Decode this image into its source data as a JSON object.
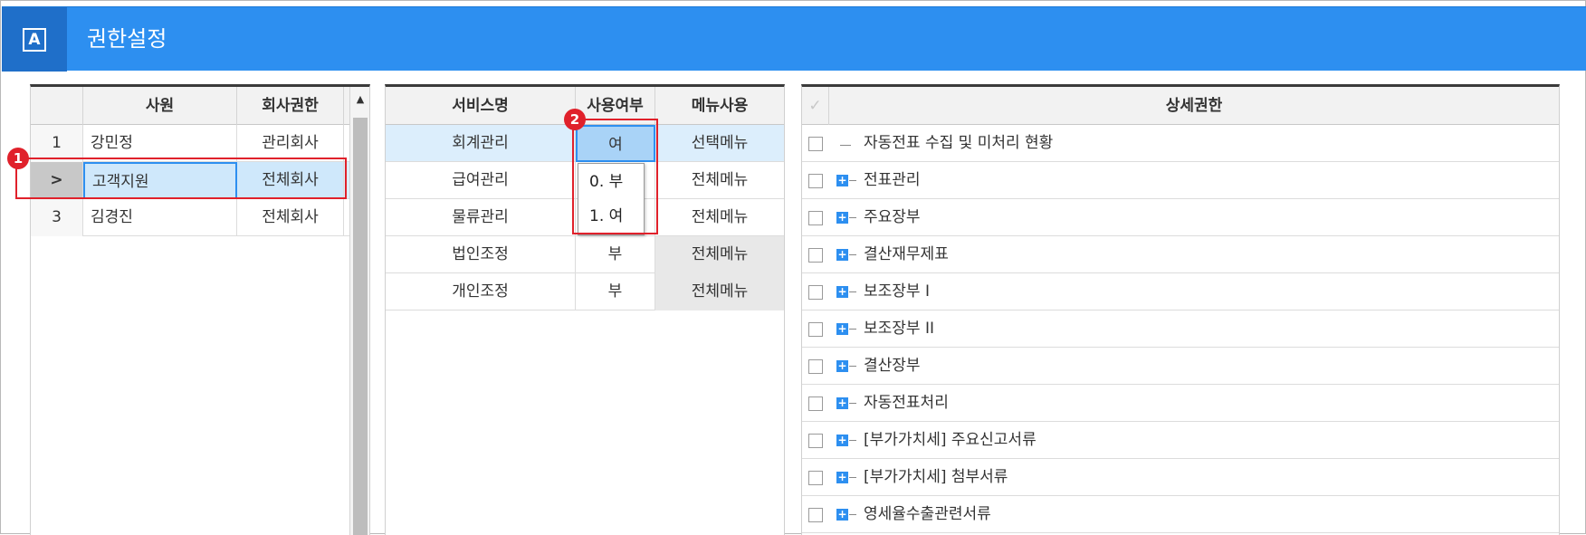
{
  "header": {
    "badge": "A",
    "title": "권한설정"
  },
  "employees": {
    "columns": [
      "사원",
      "회사권한"
    ],
    "rows": [
      {
        "num": "1",
        "name": "강민정",
        "auth": "관리회사"
      },
      {
        "num": ">",
        "name": "고객지원",
        "auth": "전체회사"
      },
      {
        "num": "3",
        "name": "김경진",
        "auth": "전체회사"
      }
    ]
  },
  "services": {
    "columns": [
      "서비스명",
      "사용여부",
      "메뉴사용"
    ],
    "rows": [
      {
        "name": "회계관리",
        "use": "여",
        "menu": "선택메뉴"
      },
      {
        "name": "급여관리",
        "use": "",
        "menu": "전체메뉴"
      },
      {
        "name": "물류관리",
        "use": "",
        "menu": "전체메뉴"
      },
      {
        "name": "법인조정",
        "use": "부",
        "menu": "전체메뉴"
      },
      {
        "name": "개인조정",
        "use": "부",
        "menu": "전체메뉴"
      }
    ],
    "dropdown_options": [
      "0. 부",
      "1. 여"
    ]
  },
  "details": {
    "column": "상세권한",
    "header_check": "✓",
    "items": [
      "자동전표 수집 및 미처리 현황",
      "전표관리",
      "주요장부",
      "결산재무제표",
      "보조장부 I",
      "보조장부 II",
      "결산장부",
      "자동전표처리",
      "[부가가치세] 주요신고서류",
      "[부가가치세] 첨부서류",
      "영세율수출관련서류"
    ]
  },
  "callouts": {
    "one": "1",
    "two": "2"
  },
  "colors": {
    "accent": "#2d8ff0",
    "selected": "#cfe8fb",
    "highlight": "#e0212b"
  }
}
